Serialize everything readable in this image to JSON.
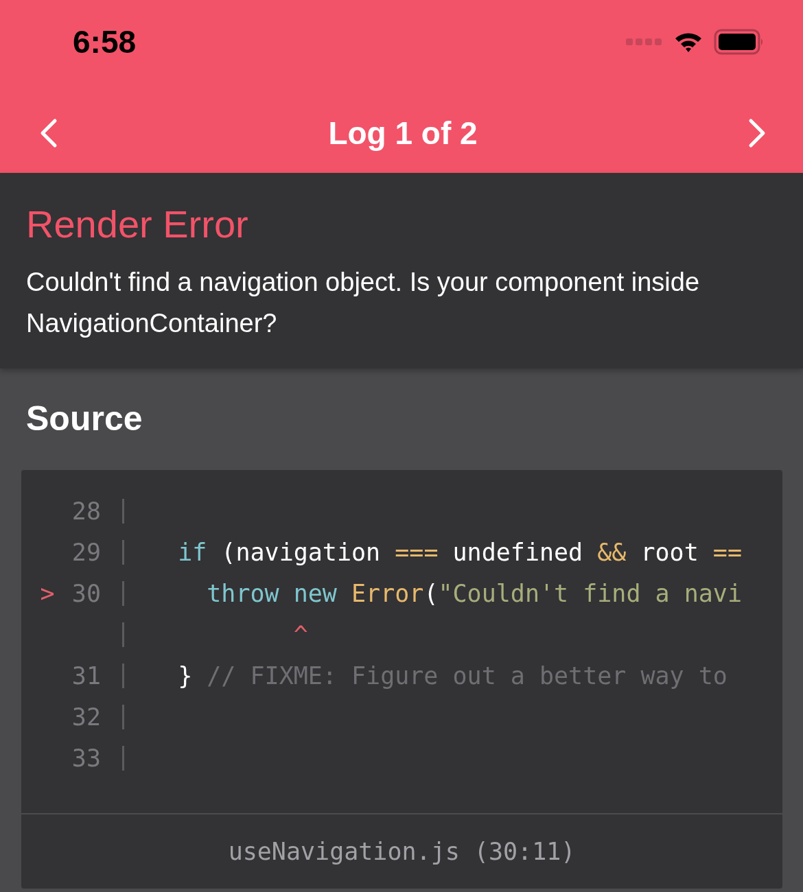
{
  "status_bar": {
    "time": "6:58"
  },
  "nav": {
    "title": "Log 1 of 2"
  },
  "error": {
    "title": "Render Error",
    "message": "Couldn't find a navigation object. Is your component inside NavigationContainer?"
  },
  "source": {
    "title": "Source",
    "lines": [
      {
        "number": "28"
      },
      {
        "number": "29",
        "tokens": [
          {
            "kind": "keyword",
            "text": "  if"
          },
          {
            "kind": "plain",
            "text": " (navigation "
          },
          {
            "kind": "operator",
            "text": "==="
          },
          {
            "kind": "plain",
            "text": " undefined "
          },
          {
            "kind": "operator",
            "text": "&&"
          },
          {
            "kind": "plain",
            "text": " root "
          },
          {
            "kind": "operator",
            "text": "=="
          }
        ]
      },
      {
        "number": "30",
        "marker": ">",
        "tokens": [
          {
            "kind": "keyword",
            "text": "    throw"
          },
          {
            "kind": "keyword",
            "text": " new"
          },
          {
            "kind": "class",
            "text": " Error"
          },
          {
            "kind": "plain",
            "text": "("
          },
          {
            "kind": "string",
            "text": "\"Couldn't find a navi"
          }
        ]
      },
      {
        "tokens": [
          {
            "kind": "caret",
            "text": "          ^"
          }
        ]
      },
      {
        "number": "31",
        "tokens": [
          {
            "kind": "plain",
            "text": "  }"
          },
          {
            "kind": "comment",
            "text": " // FIXME: Figure out a better way to"
          }
        ]
      },
      {
        "number": "32"
      },
      {
        "number": "33"
      }
    ],
    "file": "useNavigation.js (30:11)"
  }
}
